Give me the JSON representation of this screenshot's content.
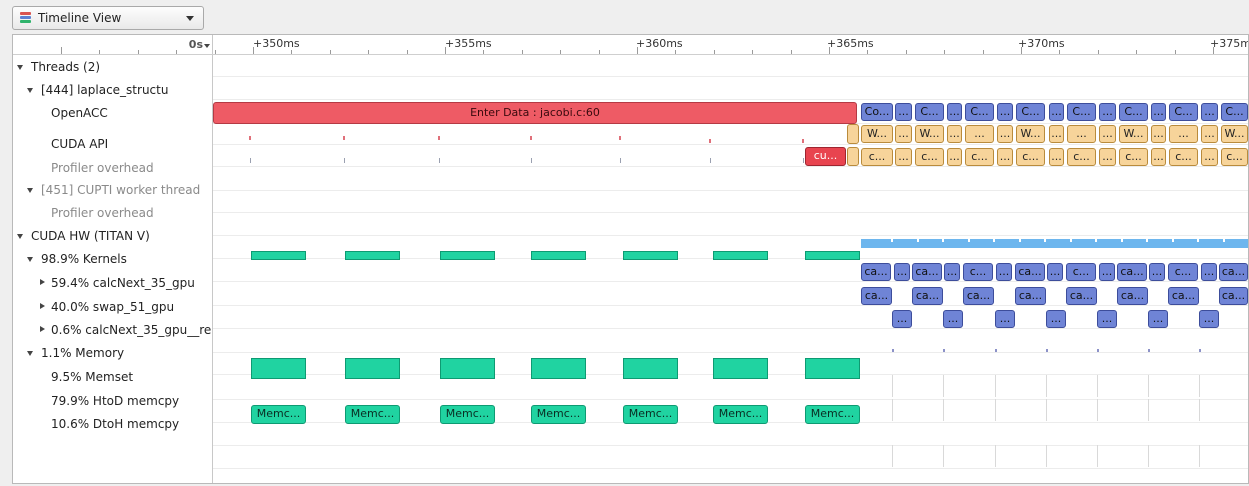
{
  "toolbar": {
    "view_selector_label": "Timeline View",
    "icon": "timeline-view-icon"
  },
  "timeline": {
    "zero_label": "0s",
    "ticks": [
      "+350ms",
      "+355ms",
      "+360ms",
      "+365ms",
      "+370ms",
      "+375m"
    ]
  },
  "tree": [
    {
      "label": "Threads (2)",
      "level": 0,
      "state": "expanded",
      "muted": false
    },
    {
      "label": "[444] laplace_structu",
      "level": 1,
      "state": "expanded",
      "muted": false
    },
    {
      "label": "OpenACC",
      "level": 2,
      "state": "none",
      "muted": false
    },
    {
      "label": "CUDA API",
      "level": 2,
      "state": "none",
      "muted": false
    },
    {
      "label": "Profiler overhead",
      "level": 2,
      "state": "none",
      "muted": true
    },
    {
      "label": "[451] CUPTI worker thread",
      "level": 1,
      "state": "expanded",
      "muted": true
    },
    {
      "label": "Profiler overhead",
      "level": 2,
      "state": "none",
      "muted": true
    },
    {
      "label": "CUDA HW (TITAN V)",
      "level": 0,
      "state": "expanded",
      "muted": false
    },
    {
      "label": "98.9% Kernels",
      "level": 1,
      "state": "expanded",
      "muted": false
    },
    {
      "label": "59.4% calcNext_35_gpu",
      "level": 2,
      "state": "collapsed",
      "muted": false
    },
    {
      "label": "40.0% swap_51_gpu",
      "level": 2,
      "state": "collapsed",
      "muted": false
    },
    {
      "label": "0.6% calcNext_35_gpu__re",
      "level": 2,
      "state": "collapsed",
      "muted": false
    },
    {
      "label": "1.1% Memory",
      "level": 1,
      "state": "expanded",
      "muted": false
    },
    {
      "label": "9.5% Memset",
      "level": 2,
      "state": "none",
      "muted": false
    },
    {
      "label": "79.9% HtoD memcpy",
      "level": 2,
      "state": "none",
      "muted": false
    },
    {
      "label": "10.6% DtoH memcpy",
      "level": 2,
      "state": "none",
      "muted": false
    }
  ],
  "events": {
    "enter_data_label": "Enter Data : jacobi.c:60",
    "cuda_api_label": "cu...",
    "memcpy_label": "Memc...",
    "openacc_compute_label": "Co...",
    "openacc_compute_short": "C...",
    "openacc_wait_label": "W...",
    "cuda_api_short": "c...",
    "kernel_label": "ca...",
    "kernel_label_alt": "c...",
    "swap_label": "...",
    "ellipsis": "..."
  },
  "colors": {
    "openacc_enter_data": "#ee5b65",
    "cuda_api_sync": "#e8444f",
    "openacc_compute": "#6f84d6",
    "cuda_api": "#f7d49a",
    "memcpy": "#20d3a1",
    "kernels_summary": "#6db6ee"
  }
}
